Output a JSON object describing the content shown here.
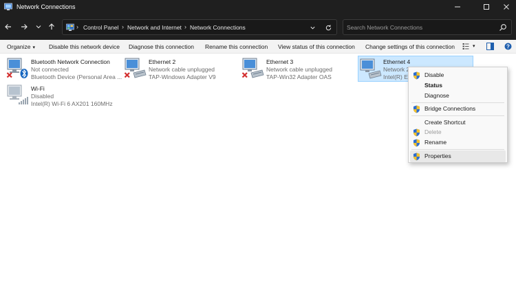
{
  "window": {
    "title": "Network Connections",
    "controls": {
      "minimize": "minimize-icon",
      "maximize": "maximize-icon",
      "close": "close-icon"
    }
  },
  "nav": {
    "breadcrumb": [
      "Control Panel",
      "Network and Internet",
      "Network Connections"
    ],
    "search_placeholder": "Search Network Connections"
  },
  "toolbar": {
    "organize": "Organize",
    "disable": "Disable this network device",
    "diagnose": "Diagnose this connection",
    "rename": "Rename this connection",
    "view_status": "View status of this connection",
    "change_settings": "Change settings of this connection"
  },
  "connections": [
    {
      "name": "Bluetooth Network Connection",
      "status": "Not connected",
      "device": "Bluetooth Device (Personal Area ...",
      "icon": "bluetooth-adapter-icon",
      "badge": "red-x"
    },
    {
      "name": "Ethernet 2",
      "status": "Network cable unplugged",
      "device": "TAP-Windows Adapter V9",
      "icon": "ethernet-adapter-icon",
      "badge": "red-x"
    },
    {
      "name": "Ethernet 3",
      "status": "Network cable unplugged",
      "device": "TAP-Win32 Adapter OAS",
      "icon": "ethernet-adapter-icon",
      "badge": "red-x"
    },
    {
      "name": "Ethernet 4",
      "status": "Network 2",
      "device": "Intel(R) Et",
      "icon": "ethernet-adapter-icon",
      "badge": "none",
      "selected": true
    },
    {
      "name": "Wi-Fi",
      "status": "Disabled",
      "device": "Intel(R) Wi-Fi 6 AX201 160MHz",
      "icon": "wifi-adapter-icon",
      "badge": "none"
    }
  ],
  "context_menu": [
    {
      "label": "Disable",
      "shield": true,
      "bold": false,
      "disabled": false
    },
    {
      "label": "Status",
      "shield": false,
      "bold": true,
      "disabled": false
    },
    {
      "label": "Diagnose",
      "shield": false,
      "bold": false,
      "disabled": false
    },
    {
      "label": "Bridge Connections",
      "shield": true,
      "bold": false,
      "disabled": false
    },
    {
      "label": "Create Shortcut",
      "shield": false,
      "bold": false,
      "disabled": false
    },
    {
      "label": "Delete",
      "shield": true,
      "bold": false,
      "disabled": true
    },
    {
      "label": "Rename",
      "shield": true,
      "bold": false,
      "disabled": false
    },
    {
      "label": "Properties",
      "shield": true,
      "bold": false,
      "disabled": false,
      "hovered": true
    }
  ],
  "colors": {
    "titlebar_bg": "#1f1f1f",
    "selection_bg": "#cce8ff",
    "selection_border": "#99d1ff",
    "error_red": "#d32f2f",
    "bluetooth_blue": "#1565c0"
  }
}
